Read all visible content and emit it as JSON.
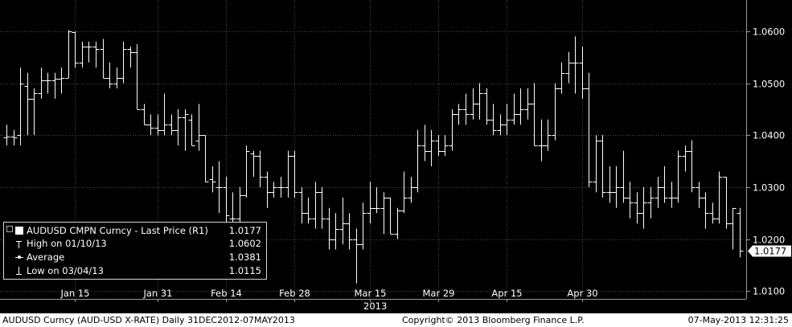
{
  "chart_data": {
    "type": "ohlc",
    "series_name": "AUDUSD CMPN Curncy - Last Price (R1)",
    "ylim": [
      1.0085,
      1.066
    ],
    "y_ticks": [
      "1.0100",
      "1.0200",
      "1.0300",
      "1.0400",
      "1.0500",
      "1.0600"
    ],
    "x_ticks": [
      {
        "label": "Jan 15",
        "index": 10
      },
      {
        "label": "Jan 31",
        "index": 22
      },
      {
        "label": "Feb 14",
        "index": 32
      },
      {
        "label": "Feb 28",
        "index": 42
      },
      {
        "label": "Mar 15",
        "index": 53
      },
      {
        "label": "Mar 29",
        "index": 63
      },
      {
        "label": "Apr 15",
        "index": 73
      },
      {
        "label": "Apr 30",
        "index": 84
      }
    ],
    "x_year_label": "2013",
    "last_price_label": "1.0177",
    "bars": [
      {
        "o": 1.0395,
        "h": 1.042,
        "l": 1.038,
        "c": 1.0398
      },
      {
        "o": 1.0398,
        "h": 1.041,
        "l": 1.038,
        "c": 1.0395
      },
      {
        "o": 1.04,
        "h": 1.053,
        "l": 1.038,
        "c": 1.05
      },
      {
        "o": 1.0495,
        "h": 1.052,
        "l": 1.04,
        "c": 1.047
      },
      {
        "o": 1.047,
        "h": 1.049,
        "l": 1.04,
        "c": 1.048
      },
      {
        "o": 1.048,
        "h": 1.053,
        "l": 1.047,
        "c": 1.0505
      },
      {
        "o": 1.0505,
        "h": 1.052,
        "l": 1.048,
        "c": 1.0505
      },
      {
        "o": 1.0505,
        "h": 1.052,
        "l": 1.047,
        "c": 1.0508
      },
      {
        "o": 1.0508,
        "h": 1.053,
        "l": 1.048,
        "c": 1.051
      },
      {
        "o": 1.051,
        "h": 1.0602,
        "l": 1.051,
        "c": 1.06
      },
      {
        "o": 1.0598,
        "h": 1.06,
        "l": 1.053,
        "c": 1.054
      },
      {
        "o": 1.054,
        "h": 1.058,
        "l": 1.053,
        "c": 1.057
      },
      {
        "o": 1.057,
        "h": 1.058,
        "l": 1.054,
        "c": 1.057
      },
      {
        "o": 1.057,
        "h": 1.058,
        "l": 1.053,
        "c": 1.0565
      },
      {
        "o": 1.0565,
        "h": 1.0585,
        "l": 1.051,
        "c": 1.051
      },
      {
        "o": 1.051,
        "h": 1.054,
        "l": 1.049,
        "c": 1.05
      },
      {
        "o": 1.05,
        "h": 1.053,
        "l": 1.049,
        "c": 1.051
      },
      {
        "o": 1.051,
        "h": 1.058,
        "l": 1.05,
        "c": 1.0565
      },
      {
        "o": 1.0565,
        "h": 1.057,
        "l": 1.053,
        "c": 1.056
      },
      {
        "o": 1.056,
        "h": 1.0575,
        "l": 1.045,
        "c": 1.045
      },
      {
        "o": 1.045,
        "h": 1.046,
        "l": 1.042,
        "c": 1.042
      },
      {
        "o": 1.042,
        "h": 1.044,
        "l": 1.04,
        "c": 1.0415
      },
      {
        "o": 1.0415,
        "h": 1.044,
        "l": 1.04,
        "c": 1.041
      },
      {
        "o": 1.041,
        "h": 1.048,
        "l": 1.04,
        "c": 1.042
      },
      {
        "o": 1.042,
        "h": 1.044,
        "l": 1.04,
        "c": 1.041
      },
      {
        "o": 1.041,
        "h": 1.045,
        "l": 1.038,
        "c": 1.0435
      },
      {
        "o": 1.0435,
        "h": 1.045,
        "l": 1.037,
        "c": 1.044
      },
      {
        "o": 1.043,
        "h": 1.044,
        "l": 1.038,
        "c": 1.038
      },
      {
        "o": 1.039,
        "h": 1.046,
        "l": 1.037,
        "c": 1.04
      },
      {
        "o": 1.04,
        "h": 1.04,
        "l": 1.031,
        "c": 1.031
      },
      {
        "o": 1.0315,
        "h": 1.034,
        "l": 1.029,
        "c": 1.031
      },
      {
        "o": 1.03,
        "h": 1.035,
        "l": 1.025,
        "c": 1.03
      },
      {
        "o": 1.03,
        "h": 1.032,
        "l": 1.022,
        "c": 1.0245
      },
      {
        "o": 1.024,
        "h": 1.029,
        "l": 1.022,
        "c": 1.024
      },
      {
        "o": 1.024,
        "h": 1.03,
        "l": 1.023,
        "c": 1.0285
      },
      {
        "o": 1.0285,
        "h": 1.038,
        "l": 1.028,
        "c": 1.037
      },
      {
        "o": 1.0365,
        "h": 1.037,
        "l": 1.032,
        "c": 1.036
      },
      {
        "o": 1.036,
        "h": 1.037,
        "l": 1.03,
        "c": 1.032
      },
      {
        "o": 1.032,
        "h": 1.033,
        "l": 1.026,
        "c": 1.029
      },
      {
        "o": 1.029,
        "h": 1.031,
        "l": 1.028,
        "c": 1.03
      },
      {
        "o": 1.03,
        "h": 1.032,
        "l": 1.028,
        "c": 1.03
      },
      {
        "o": 1.03,
        "h": 1.037,
        "l": 1.028,
        "c": 1.036
      },
      {
        "o": 1.036,
        "h": 1.037,
        "l": 1.028,
        "c": 1.029
      },
      {
        "o": 1.029,
        "h": 1.03,
        "l": 1.023,
        "c": 1.025
      },
      {
        "o": 1.025,
        "h": 1.028,
        "l": 1.023,
        "c": 1.024
      },
      {
        "o": 1.024,
        "h": 1.031,
        "l": 1.022,
        "c": 1.029
      },
      {
        "o": 1.029,
        "h": 1.03,
        "l": 1.022,
        "c": 1.024
      },
      {
        "o": 1.024,
        "h": 1.026,
        "l": 1.018,
        "c": 1.02
      },
      {
        "o": 1.02,
        "h": 1.025,
        "l": 1.018,
        "c": 1.022
      },
      {
        "o": 1.022,
        "h": 1.028,
        "l": 1.019,
        "c": 1.023
      },
      {
        "o": 1.023,
        "h": 1.025,
        "l": 1.018,
        "c": 1.02
      },
      {
        "o": 1.02,
        "h": 1.022,
        "l": 1.0115,
        "c": 1.019
      },
      {
        "o": 1.019,
        "h": 1.027,
        "l": 1.018,
        "c": 1.025
      },
      {
        "o": 1.025,
        "h": 1.031,
        "l": 1.023,
        "c": 1.026
      },
      {
        "o": 1.026,
        "h": 1.03,
        "l": 1.025,
        "c": 1.026
      },
      {
        "o": 1.026,
        "h": 1.029,
        "l": 1.021,
        "c": 1.028
      },
      {
        "o": 1.028,
        "h": 1.028,
        "l": 1.021,
        "c": 1.021
      },
      {
        "o": 1.021,
        "h": 1.026,
        "l": 1.02,
        "c": 1.0255
      },
      {
        "o": 1.0255,
        "h": 1.033,
        "l": 1.025,
        "c": 1.028
      },
      {
        "o": 1.028,
        "h": 1.032,
        "l": 1.027,
        "c": 1.03
      },
      {
        "o": 1.03,
        "h": 1.041,
        "l": 1.029,
        "c": 1.038
      },
      {
        "o": 1.038,
        "h": 1.042,
        "l": 1.035,
        "c": 1.037
      },
      {
        "o": 1.037,
        "h": 1.041,
        "l": 1.034,
        "c": 1.039
      },
      {
        "o": 1.039,
        "h": 1.04,
        "l": 1.036,
        "c": 1.037
      },
      {
        "o": 1.037,
        "h": 1.04,
        "l": 1.036,
        "c": 1.038
      },
      {
        "o": 1.038,
        "h": 1.045,
        "l": 1.037,
        "c": 1.044
      },
      {
        "o": 1.044,
        "h": 1.046,
        "l": 1.042,
        "c": 1.045
      },
      {
        "o": 1.045,
        "h": 1.048,
        "l": 1.042,
        "c": 1.044
      },
      {
        "o": 1.044,
        "h": 1.049,
        "l": 1.043,
        "c": 1.046
      },
      {
        "o": 1.046,
        "h": 1.05,
        "l": 1.043,
        "c": 1.048
      },
      {
        "o": 1.048,
        "h": 1.049,
        "l": 1.042,
        "c": 1.043
      },
      {
        "o": 1.043,
        "h": 1.046,
        "l": 1.04,
        "c": 1.041
      },
      {
        "o": 1.041,
        "h": 1.044,
        "l": 1.04,
        "c": 1.042
      },
      {
        "o": 1.042,
        "h": 1.046,
        "l": 1.04,
        "c": 1.043
      },
      {
        "o": 1.043,
        "h": 1.048,
        "l": 1.042,
        "c": 1.044
      },
      {
        "o": 1.044,
        "h": 1.049,
        "l": 1.042,
        "c": 1.045
      },
      {
        "o": 1.045,
        "h": 1.049,
        "l": 1.043,
        "c": 1.046
      },
      {
        "o": 1.046,
        "h": 1.05,
        "l": 1.038,
        "c": 1.038
      },
      {
        "o": 1.038,
        "h": 1.043,
        "l": 1.035,
        "c": 1.038
      },
      {
        "o": 1.038,
        "h": 1.043,
        "l": 1.037,
        "c": 1.04
      },
      {
        "o": 1.04,
        "h": 1.05,
        "l": 1.039,
        "c": 1.049
      },
      {
        "o": 1.049,
        "h": 1.054,
        "l": 1.048,
        "c": 1.052
      },
      {
        "o": 1.052,
        "h": 1.056,
        "l": 1.05,
        "c": 1.054
      },
      {
        "o": 1.054,
        "h": 1.059,
        "l": 1.048,
        "c": 1.054
      },
      {
        "o": 1.054,
        "h": 1.057,
        "l": 1.047,
        "c": 1.049
      },
      {
        "o": 1.049,
        "h": 1.052,
        "l": 1.03,
        "c": 1.031
      },
      {
        "o": 1.031,
        "h": 1.04,
        "l": 1.029,
        "c": 1.039
      },
      {
        "o": 1.039,
        "h": 1.04,
        "l": 1.028,
        "c": 1.029
      },
      {
        "o": 1.029,
        "h": 1.034,
        "l": 1.027,
        "c": 1.029
      },
      {
        "o": 1.029,
        "h": 1.034,
        "l": 1.026,
        "c": 1.03
      },
      {
        "o": 1.03,
        "h": 1.037,
        "l": 1.027,
        "c": 1.028
      },
      {
        "o": 1.028,
        "h": 1.031,
        "l": 1.024,
        "c": 1.027
      },
      {
        "o": 1.027,
        "h": 1.029,
        "l": 1.023,
        "c": 1.025
      },
      {
        "o": 1.025,
        "h": 1.03,
        "l": 1.022,
        "c": 1.027
      },
      {
        "o": 1.027,
        "h": 1.03,
        "l": 1.024,
        "c": 1.028
      },
      {
        "o": 1.028,
        "h": 1.032,
        "l": 1.026,
        "c": 1.03
      },
      {
        "o": 1.03,
        "h": 1.034,
        "l": 1.027,
        "c": 1.028
      },
      {
        "o": 1.028,
        "h": 1.031,
        "l": 1.026,
        "c": 1.028
      },
      {
        "o": 1.028,
        "h": 1.037,
        "l": 1.027,
        "c": 1.036
      },
      {
        "o": 1.036,
        "h": 1.038,
        "l": 1.033,
        "c": 1.037
      },
      {
        "o": 1.037,
        "h": 1.039,
        "l": 1.029,
        "c": 1.03
      },
      {
        "o": 1.03,
        "h": 1.031,
        "l": 1.026,
        "c": 1.028
      },
      {
        "o": 1.028,
        "h": 1.029,
        "l": 1.022,
        "c": 1.025
      },
      {
        "o": 1.025,
        "h": 1.027,
        "l": 1.023,
        "c": 1.024
      },
      {
        "o": 1.024,
        "h": 1.033,
        "l": 1.023,
        "c": 1.032
      },
      {
        "o": 1.032,
        "h": 1.032,
        "l": 1.022,
        "c": 1.023
      },
      {
        "o": 1.023,
        "h": 1.026,
        "l": 1.018,
        "c": 1.026
      },
      {
        "o": 1.025,
        "h": 1.026,
        "l": 1.0165,
        "c": 1.0177
      }
    ]
  },
  "legend": {
    "rows": [
      {
        "label": "AUDUSD CMPN Curncy - Last Price (R1)",
        "value": "1.0177"
      },
      {
        "label": "High on 01/10/13",
        "value": "1.0602"
      },
      {
        "label": "Average",
        "value": "1.0381"
      },
      {
        "label": "Low on 03/04/13",
        "value": "1.0115"
      }
    ]
  },
  "footer": {
    "left": "AUDUSD Curncy (AUD-USD X-RATE)  Daily 31DEC2012-07MAY2013",
    "center": "Copyright© 2013 Bloomberg Finance L.P.",
    "right": "07-May-2013 12:31:25"
  },
  "colors": {
    "background": "#000000",
    "grid": "#5a5a5a",
    "bars": "#ffffff",
    "footer_bg": "#ffffff"
  }
}
